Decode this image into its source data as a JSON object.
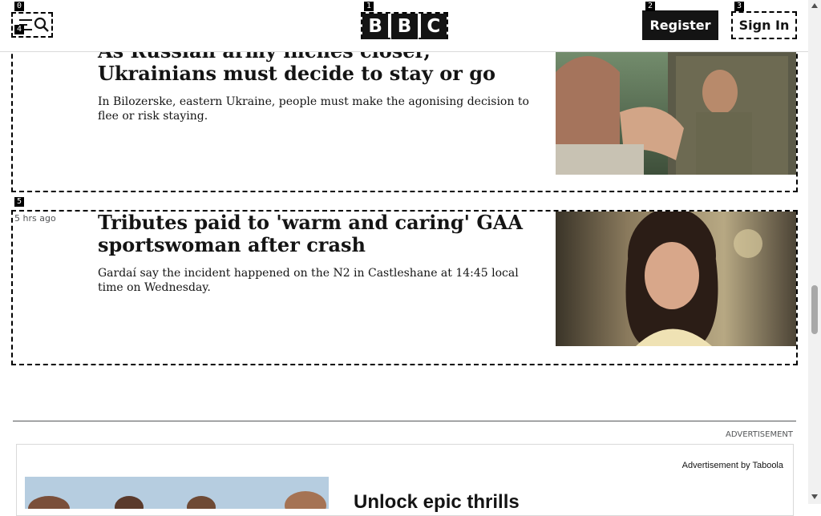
{
  "header": {
    "logo_letters": [
      "B",
      "B",
      "C"
    ],
    "register_label": "Register",
    "signin_label": "Sign In",
    "menu_icon": "menu-icon",
    "search_icon": "search-icon"
  },
  "markers": [
    "0",
    "1",
    "2",
    "3",
    "4",
    "5"
  ],
  "articles": [
    {
      "headline": "As Russian army inches closer, Ukrainians must decide to stay or go",
      "summary": "In Bilozerske, eastern Ukraine, people must make the agonising decision to flee or risk staying.",
      "timestamp": ""
    },
    {
      "headline": "Tributes paid to 'warm and caring' GAA sportswoman after crash",
      "summary": "Gardaí say the incident happened on the N2 in Castleshane at 14:45 local time on Wednesday.",
      "timestamp": "5 hrs ago"
    }
  ],
  "ad": {
    "label": "ADVERTISEMENT",
    "by": "Advertisement by Taboola",
    "title": "Unlock epic thrills"
  },
  "colors": {
    "text": "#141414",
    "muted": "#545658",
    "button_bg": "#141414",
    "button_text": "#ffffff"
  }
}
